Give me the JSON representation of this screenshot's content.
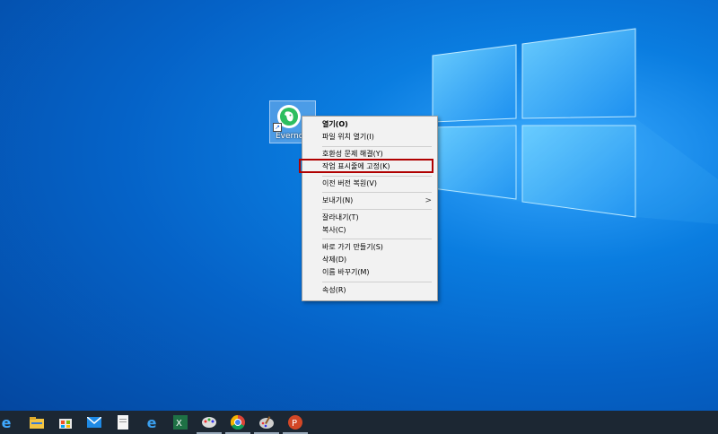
{
  "desktop": {
    "icon": {
      "label": "Evernote",
      "name": "evernote-icon"
    }
  },
  "context_menu": {
    "items": [
      {
        "label": "열기(O)",
        "bold": true
      },
      {
        "label": "파일 위치 열기(I)"
      },
      {
        "label": "호환성 문제 해결(Y)"
      },
      {
        "label": "작업 표시줄에 고정(K)"
      },
      {
        "label": "이전 버전 복원(V)"
      },
      {
        "label": "보내기(N)",
        "submenu": true
      },
      {
        "label": "잘라내기(T)"
      },
      {
        "label": "복사(C)"
      },
      {
        "label": "바로 가기 만들기(S)"
      },
      {
        "label": "삭제(D)"
      },
      {
        "label": "이름 바꾸기(M)"
      },
      {
        "label": "속성(R)"
      }
    ],
    "highlight_color": "#b00000"
  },
  "taskbar": {
    "icons": [
      "edge-icon",
      "file-explorer-icon",
      "store-icon",
      "mail-icon",
      "notepad-icon",
      "internet-explorer-icon",
      "excel-icon",
      "paint-icon",
      "chrome-icon",
      "paint-brush-icon",
      "powerpoint-icon"
    ],
    "background": "#1c2733"
  }
}
